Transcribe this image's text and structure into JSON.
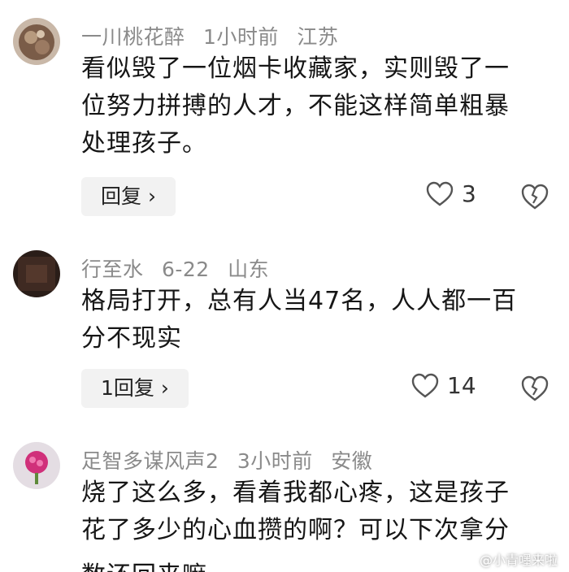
{
  "comments": [
    {
      "username": "一川桃花醉",
      "time": "1小时前",
      "location": "江苏",
      "lines": [
        "看似毁了一位烟卡收藏家，实则毁了一",
        "位努力拼搏的人才，不能这样简单粗暴",
        "处理孩子。"
      ],
      "reply_label": "回复 ›",
      "likes": "3"
    },
    {
      "username": "行至水",
      "time": "6-22",
      "location": "山东",
      "lines": [
        "格局打开，总有人当47名，人人都一百",
        "分不现实"
      ],
      "reply_label": "1回复 ›",
      "likes": "14"
    },
    {
      "username": "足智多谋风声2",
      "time": "3小时前",
      "location": "安徽",
      "lines": [
        "烧了这么多，看着我都心疼，这是孩子",
        "花了多少的心血攒的啊？可以下次拿分",
        "数还回来嘛"
      ]
    }
  ],
  "watermark": "@小青嚜来啦",
  "colors": {
    "meta": "#8a8a8a",
    "text": "#161616",
    "reply_bg": "#f2f2f2"
  }
}
